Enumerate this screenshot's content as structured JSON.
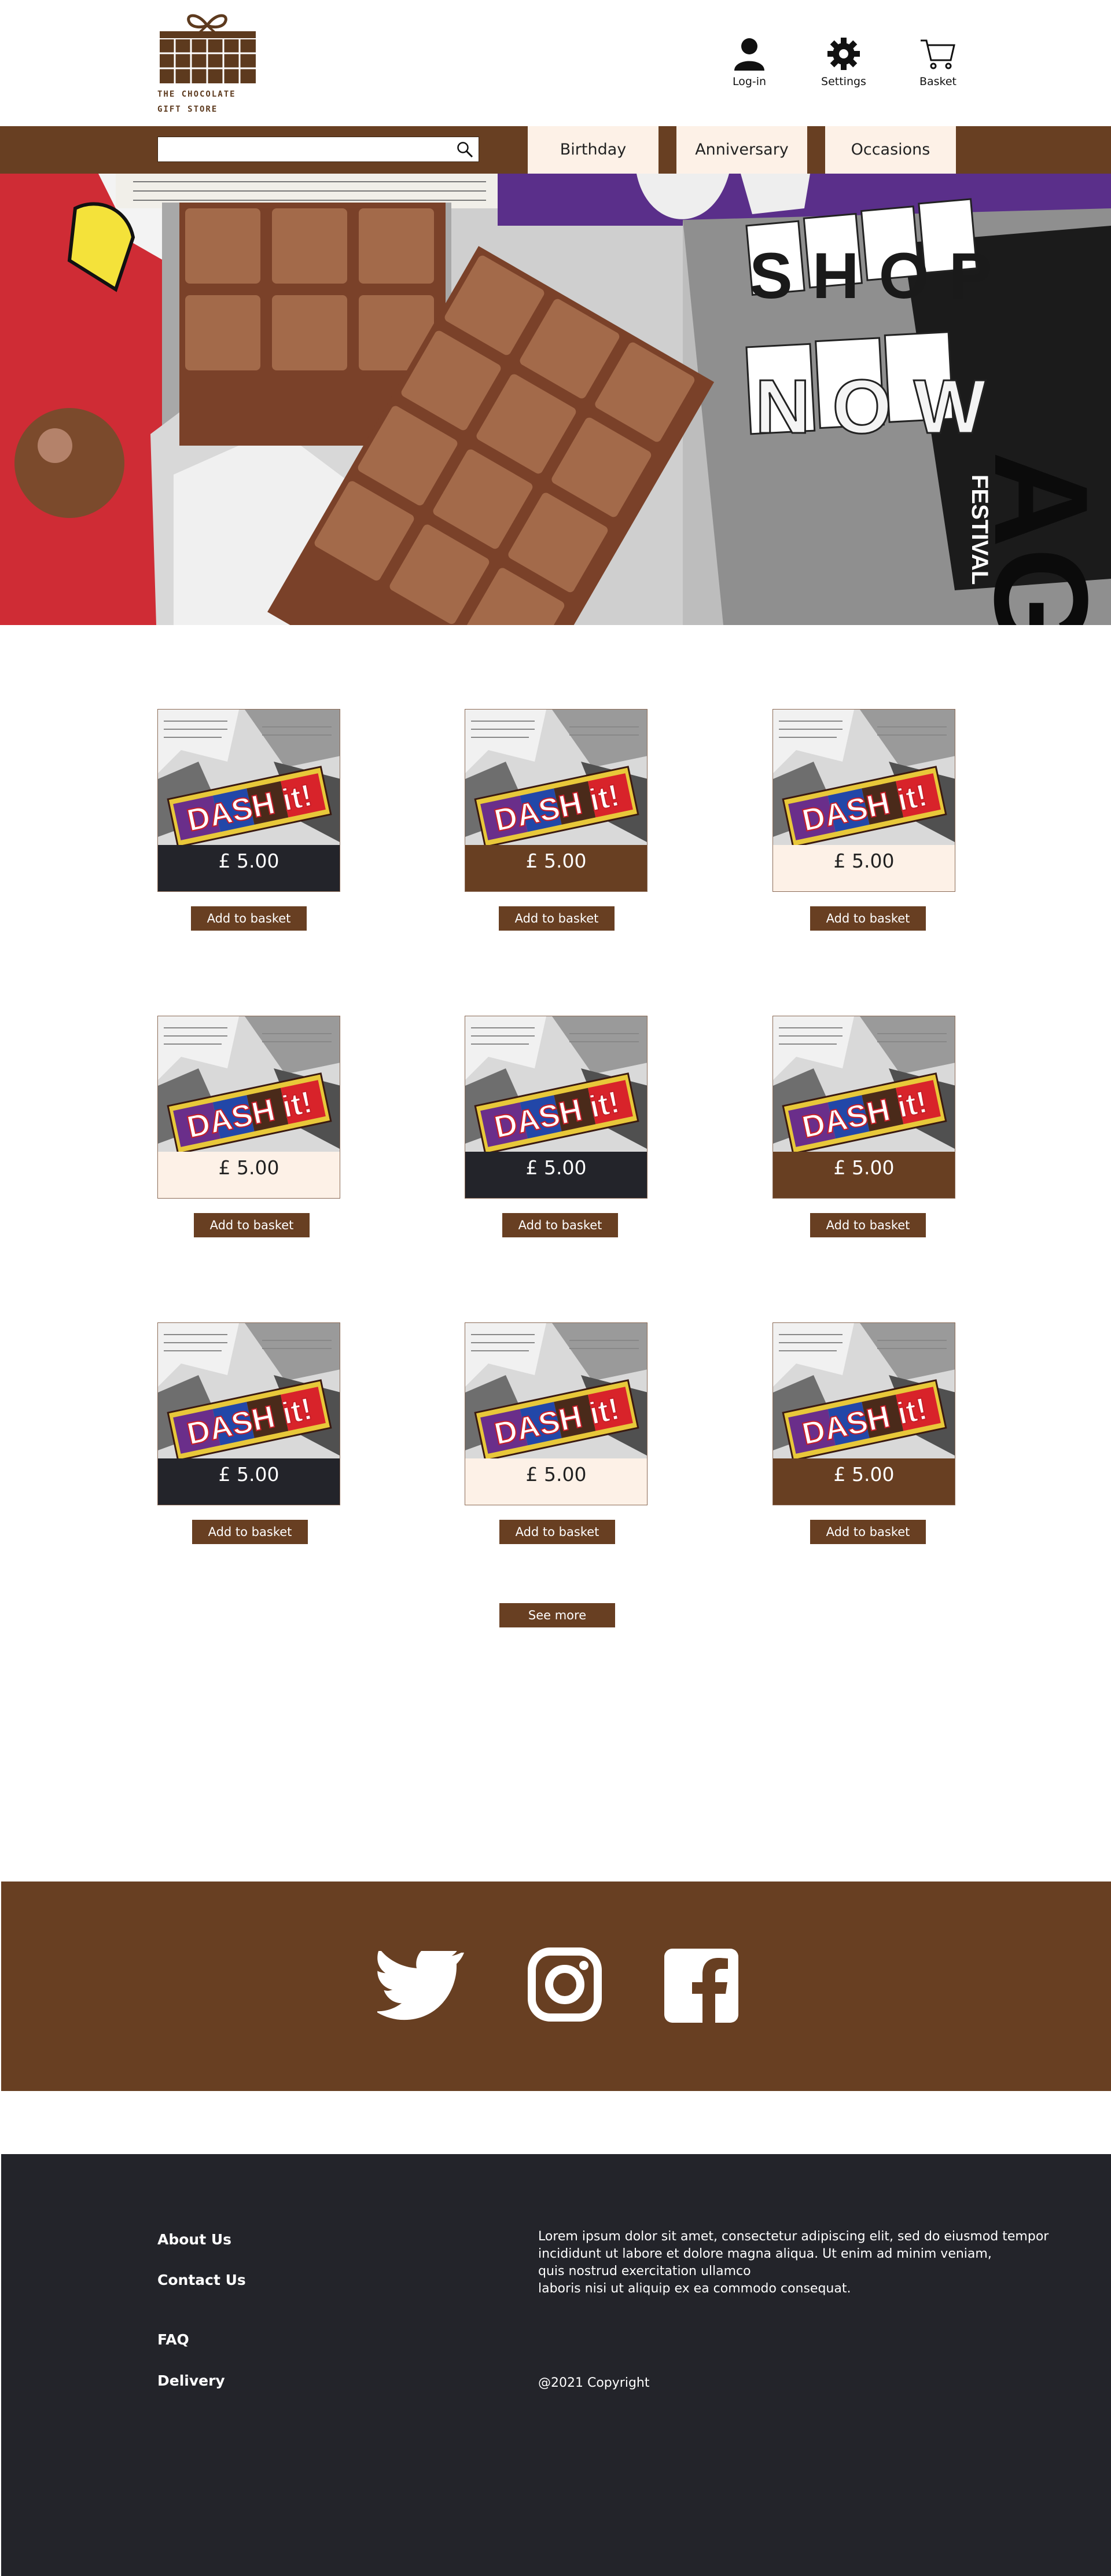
{
  "header": {
    "logo_text": "THE CHOCOLATE GIFT STORE",
    "icons": [
      {
        "label": "Log-in",
        "icon": "user-icon"
      },
      {
        "label": "Settings",
        "icon": "gear-icon"
      },
      {
        "label": "Basket",
        "icon": "cart-icon"
      }
    ]
  },
  "nav": {
    "search_placeholder": "",
    "tabs": [
      "Birthday",
      "Anniversary",
      "Occasions"
    ]
  },
  "hero": {
    "headline_line1": "SHOP",
    "headline_line2": "NOW",
    "bar_brand_text": "DASH it!",
    "poster_text": "AGIT",
    "poster_small": "FESTIVAL"
  },
  "products": [
    {
      "price": "£ 5.00",
      "button": "Add to basket",
      "band": "dark"
    },
    {
      "price": "£ 5.00",
      "button": "Add to basket",
      "band": "brown"
    },
    {
      "price": "£ 5.00",
      "button": "Add to basket",
      "band": "cream"
    },
    {
      "price": "£ 5.00",
      "button": "Add to basket",
      "band": "cream"
    },
    {
      "price": "£ 5.00",
      "button": "Add to basket",
      "band": "dark"
    },
    {
      "price": "£ 5.00",
      "button": "Add to basket",
      "band": "brown"
    },
    {
      "price": "£ 5.00",
      "button": "Add to basket",
      "band": "dark"
    },
    {
      "price": "£ 5.00",
      "button": "Add to basket",
      "band": "cream"
    },
    {
      "price": "£ 5.00",
      "button": "Add to basket",
      "band": "brown"
    }
  ],
  "see_more": "See more",
  "social": [
    "twitter-icon",
    "instagram-icon",
    "facebook-icon"
  ],
  "footer": {
    "links": [
      "About Us",
      "Contact Us",
      "FAQ",
      "Delivery"
    ],
    "text": "Lorem ipsum dolor sit amet, consectetur adipiscing elit, sed do eiusmod tempor\nincididunt ut labore et dolore magna aliqua. Ut enim ad minim veniam,\nquis nostrud exercitation ullamco\nlaboris nisi ut aliquip ex ea commodo consequat.",
    "copyright": "@2021 Copyright"
  },
  "colors": {
    "brown": "#683f22",
    "cream": "#fdf1e7",
    "dark": "#23242a"
  }
}
